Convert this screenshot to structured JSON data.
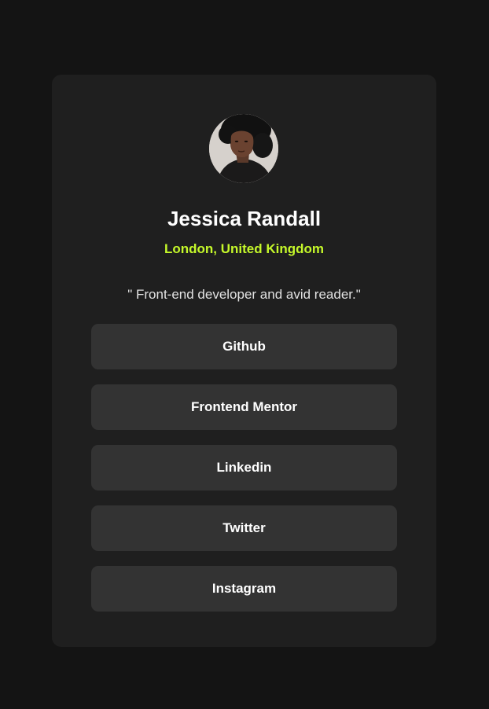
{
  "profile": {
    "name": "Jessica Randall",
    "location": "London, United Kingdom",
    "bio": "\" Front-end developer and avid reader.\"",
    "avatar_icon": "profile-photo"
  },
  "links": [
    {
      "label": "Github"
    },
    {
      "label": "Frontend Mentor"
    },
    {
      "label": "Linkedin"
    },
    {
      "label": "Twitter"
    },
    {
      "label": "Instagram"
    }
  ],
  "colors": {
    "background": "#141414",
    "card": "#1f1f1f",
    "button": "#333333",
    "accent": "#c5f82a",
    "text": "#ffffff"
  }
}
